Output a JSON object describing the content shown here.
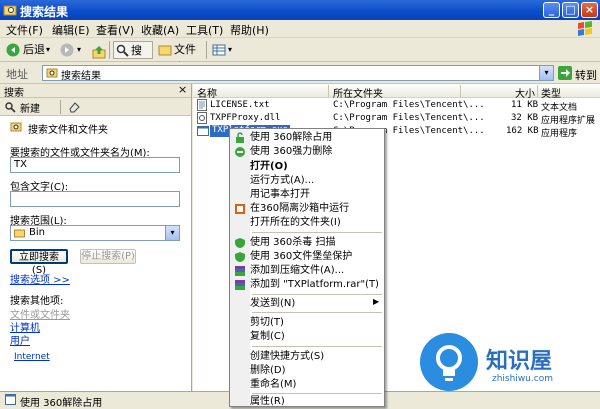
{
  "window": {
    "title": "搜索结果"
  },
  "menubar": {
    "items": [
      "文件(F)",
      "编辑(E)",
      "查看(V)",
      "收藏(A)",
      "工具(T)",
      "帮助(H)"
    ]
  },
  "toolbar": {
    "back": "后退",
    "search": "搜索",
    "folders": "文件夹"
  },
  "address": {
    "label": "地址",
    "value": "搜索结果",
    "go": "转到"
  },
  "left_pane": {
    "header": "搜索",
    "new_button": "新建",
    "section_title": "搜索文件和文件夹",
    "name_label": "要搜索的文件或文件夹名为(M):",
    "name_value": "TX",
    "contains_label": "包含文字(C):",
    "contains_value": "",
    "scope_label": "搜索范围(L):",
    "scope_value": "Bin",
    "search_now": "立即搜索(S)",
    "stop_search": "停止搜索(P)",
    "options_link": "搜索选项 >>",
    "other_label": "搜索其他项:",
    "other_links": [
      "文件或文件夹",
      "计算机",
      "用户",
      "Internet"
    ]
  },
  "columns": {
    "name": "名称",
    "folder": "所在文件夹",
    "size": "大小",
    "type": "类型"
  },
  "files": [
    {
      "name": "LICENSE.txt",
      "folder": "C:\\Program Files\\Tencent\\...",
      "size": "11 KB",
      "type": "文本文档"
    },
    {
      "name": "TXPFProxy.dll",
      "folder": "C:\\Program Files\\Tencent\\...",
      "size": "32 KB",
      "type": "应用程序扩展"
    },
    {
      "name": "TXPlatform.exe",
      "folder": "C:\\Program Files\\Tencent\\...",
      "size": "162 KB",
      "type": "应用程序"
    }
  ],
  "context_menu": {
    "items": [
      "使用 360解除占用",
      "使用 360强力删除",
      "打开(O)",
      "运行方式(A)...",
      "用记事本打开",
      "在360隔离沙箱中运行",
      "打开所在的文件夹(I)",
      "使用 360杀毒 扫描",
      "使用 360文件堡垒保护",
      "添加到压缩文件(A)...",
      "添加到 \"TXPlatform.rar\"(T)",
      "发送到(N)",
      "剪切(T)",
      "复制(C)",
      "创建快捷方式(S)",
      "删除(D)",
      "重命名(M)",
      "属性(R)"
    ]
  },
  "status": {
    "text": "使用 360解除占用"
  },
  "watermark": {
    "title": "知识屋",
    "subtitle": "zhishiwu.com"
  },
  "colors": {
    "titlebar": "#0a4bc8",
    "selection": "#316ac5",
    "link": "#0033cc"
  }
}
